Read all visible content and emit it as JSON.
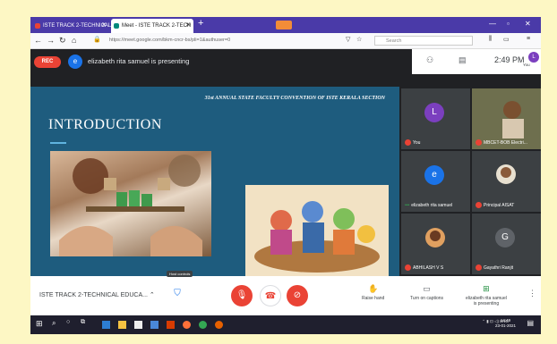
{
  "browser": {
    "tabs": [
      {
        "label": "ISTE TRACK 2-TECHNICAL EDUC",
        "icon": "gmail-icon",
        "color": "#ea4335"
      },
      {
        "label": "Meet - ISTE TRACK 2-TECH",
        "icon": "meet-icon",
        "color": "#00897b"
      }
    ],
    "url": "https://meet.google.com/bkm-cncr-bs/pli=1&authuser=0",
    "search_placeholder": "Search"
  },
  "meet": {
    "rec_label": "REC",
    "presenter_initial": "e",
    "presenting_text": "elizabeth rita samuel is presenting",
    "clock": "2:49 PM",
    "me_label": "You",
    "me_initial": "L"
  },
  "slide": {
    "header": "31st ANNUAL STATE FACULTY CONVENTION OF ISTE KERALA SECTION",
    "title": "INTRODUCTION"
  },
  "participants": [
    {
      "name": "You",
      "initial": "L",
      "color": "#7b3fbf",
      "photo": false
    },
    {
      "name": "MBCET-BOB Electri...",
      "initial": "",
      "color": "#3c4043",
      "photo": true
    },
    {
      "name": "elizabeth rita samuel",
      "initial": "e",
      "color": "#1a73e8",
      "photo": false
    },
    {
      "name": "Principal AISAT",
      "initial": "",
      "color": "#3c4043",
      "photo": true
    },
    {
      "name": "ABHILASH V S",
      "initial": "",
      "color": "#3c4043",
      "photo": true
    },
    {
      "name": "Gayathri Ranjit",
      "initial": "G",
      "color": "#5f6368",
      "photo": false
    }
  ],
  "controls": {
    "meeting_name": "ISTE TRACK 2-TECHNICAL EDUCA...",
    "host_label": "Host controls",
    "raise_hand": "Raise hand",
    "captions": "Turn on captions",
    "presenting_line1": "elizabeth rita samuel",
    "presenting_line2": "is presenting"
  },
  "taskbar": {
    "tray": "ENG",
    "time": "14:49",
    "date": "23-01-2021"
  }
}
